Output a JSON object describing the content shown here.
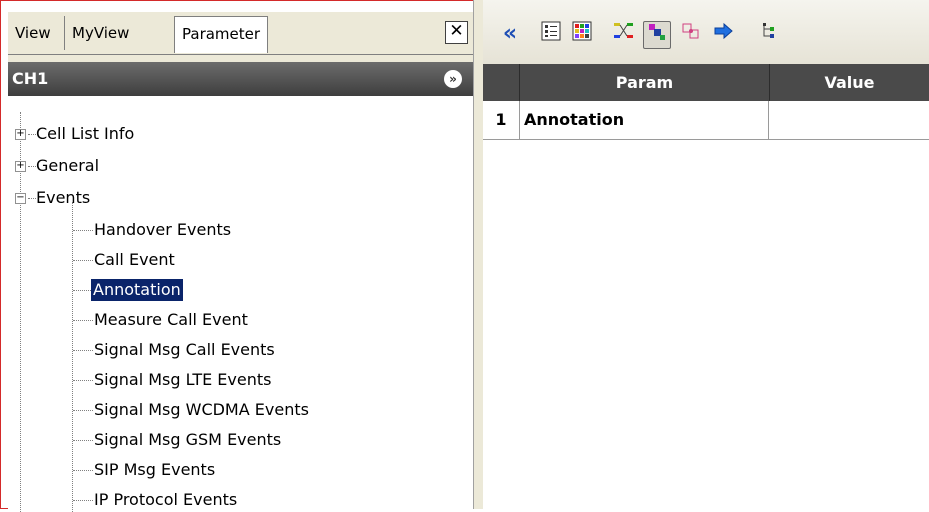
{
  "tabs": [
    "View",
    "MyView",
    "Parameter"
  ],
  "close_label": "✕",
  "channel": "CH1",
  "tree": {
    "cell_list_info": "Cell List Info",
    "general": "General",
    "events": "Events",
    "children": [
      "Handover Events",
      "Call Event",
      "Annotation",
      "Measure Call Event",
      "Signal Msg Call Events",
      "Signal Msg LTE Events",
      "Signal Msg WCDMA Events",
      "Signal Msg GSM Events",
      "SIP Msg Events",
      "IP Protocol Events"
    ],
    "selected": "Annotation"
  },
  "grid": {
    "columns": [
      "Param",
      "Value"
    ],
    "rows": [
      {
        "index": "1",
        "param": "Annotation",
        "value": ""
      }
    ]
  },
  "toolbar_icons": [
    "collapse-left-icon",
    "list-view-icon",
    "color-grid-icon",
    "flow-diagram-icon",
    "block-view-icon",
    "map-icon",
    "forward-arrow-icon",
    "tree-layout-icon"
  ]
}
